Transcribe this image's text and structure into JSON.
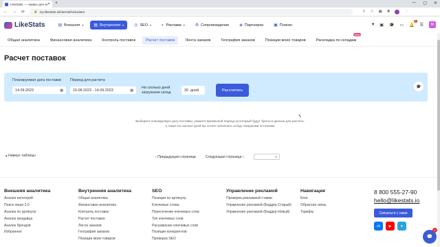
{
  "browser": {
    "tab_title": "LikeStats — сервис для аналити...",
    "new_tab": "+",
    "window_controls": [
      "—",
      "▢",
      "✕"
    ],
    "url": "my.likestats.io/internal/calculator",
    "nav": [
      "←",
      "→",
      "⟳"
    ]
  },
  "header": {
    "logo": "LikeStats",
    "menu": [
      {
        "label": "Внешняя",
        "icon": "chart-icon",
        "glyph": "▤",
        "chevron": "▾",
        "active": false
      },
      {
        "label": "Внутренняя",
        "icon": "chart-icon",
        "glyph": "▤",
        "chevron": "▾",
        "active": true
      },
      {
        "label": "SEO",
        "icon": "seo-icon",
        "glyph": "◎",
        "chevron": "▾",
        "active": false
      },
      {
        "label": "Реклама",
        "icon": "ads-icon",
        "glyph": "◐",
        "chevron": "▾",
        "active": false
      },
      {
        "label": "Сопровождение",
        "icon": "support-icon",
        "glyph": "⚙",
        "chevron": "",
        "active": false
      },
      {
        "label": "Партнерка",
        "icon": "partner-icon",
        "glyph": "◈",
        "chevron": "",
        "active": false
      },
      {
        "label": "Плагин",
        "icon": "plugin-icon",
        "glyph": "▣",
        "chevron": "",
        "active": false
      }
    ],
    "notifications_count": "6",
    "user_initial": "M"
  },
  "subnav": {
    "items": [
      {
        "label": "Общая аналитика",
        "active": false,
        "badge": ""
      },
      {
        "label": "Финансовая аналитика",
        "active": false,
        "badge": ""
      },
      {
        "label": "Контроль поставок",
        "active": false,
        "badge": ""
      },
      {
        "label": "Расчет поставок",
        "active": true,
        "badge": ""
      },
      {
        "label": "Лента заказов",
        "active": false,
        "badge": ""
      },
      {
        "label": "География заказов",
        "active": false,
        "badge": ""
      },
      {
        "label": "Позиции моих товаров",
        "active": false,
        "badge": ""
      },
      {
        "label": "Раскладка по складам",
        "active": false,
        "badge": "New"
      }
    ]
  },
  "page": {
    "title": "Расчет поставок",
    "filters": {
      "delivery_date_label": "Планируемая дата поставки",
      "delivery_date_value": "14.09.2023",
      "period_label": "Период для расчета",
      "period_value": "15.08.2023 - 14.09.2023",
      "days_label": "На сколько дней загружаем склад",
      "days_value": "30",
      "days_unit": "дней",
      "calc_button": "Рассчитать"
    },
    "info_line1": "Выберите планируемую дату поставки, укажите временной период за который будут браться данные для расчета,",
    "info_line2": "а также на сколько дней вы хотите заполнить склад товарными остатками",
    "table_name_label": "Наверх таблицы",
    "pager": {
      "prev": "Предыдущая страница",
      "next": "Следующая страница"
    }
  },
  "footer": {
    "columns": [
      {
        "title": "Внешняя аналитика",
        "links": [
          "Анализ категорий",
          "Поиск ниши 2.0",
          "Анализ по артикулу",
          "Анализ продавца",
          "Анализ брендов",
          "Избранное"
        ]
      },
      {
        "title": "Внутренняя аналитика",
        "links": [
          "Общая аналитика",
          "Финансовая аналитика",
          "Контроль поставок",
          "Расчет поставок",
          "Лента заказов",
          "География заказов",
          "Позиции моих товаров"
        ]
      },
      {
        "title": "SEO",
        "links": [
          "Позиции по артикулу",
          "Ключевые слова",
          "Пересечение ключевых слов",
          "Топ ключевых слов",
          "Расширение ключевых слов",
          "Позиции конкурентов",
          "Проверка SEO"
        ]
      },
      {
        "title": "Управление рекламой",
        "links": [
          "Проверка рекламной ставки",
          "Управление рекламой (Биддер Старый)",
          "Управление рекламой (Биддер Новый)"
        ]
      },
      {
        "title": "Навигация",
        "links": [
          "Блог",
          "Обратная связь",
          "Тарифы"
        ]
      }
    ],
    "phone": "8 800 555-27-90",
    "email": "hello@likestats.io",
    "contact_button": "Связаться с нами",
    "socials": [
      {
        "icon": "vk-icon",
        "glyph": "vk",
        "color": "#0077ff"
      },
      {
        "icon": "youtube-icon",
        "glyph": "▶",
        "color": "#ff0000"
      },
      {
        "icon": "telegram-icon",
        "glyph": "➤",
        "color": "#2aa3de"
      }
    ],
    "chat_badge": "1"
  },
  "colors": {
    "accent": "#3b5bdb",
    "panel": "#d0ebff",
    "badge": "#e64980"
  }
}
